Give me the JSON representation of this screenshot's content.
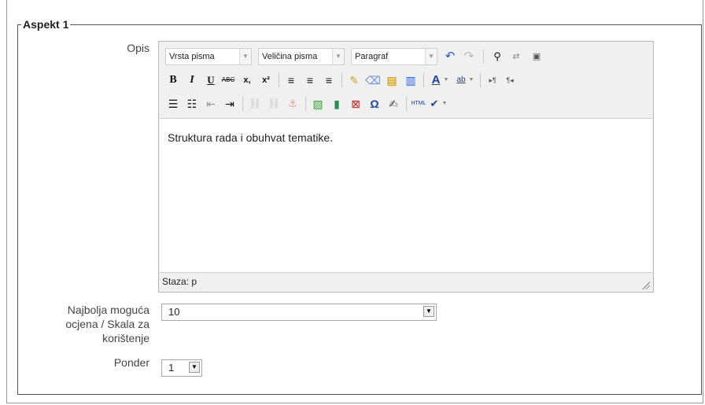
{
  "fieldset": {
    "legend": "Aspekt 1"
  },
  "form": {
    "description_label": "Opis",
    "best_grade_label_line1": "Najbolja moguća",
    "best_grade_label_line2": "ocjena / Skala za",
    "best_grade_label_line3": "korištenje",
    "best_grade_value": "10",
    "weight_label": "Ponder",
    "weight_value": "1"
  },
  "editor": {
    "font_family": "Vrsta pisma",
    "font_size": "Veličina pisma",
    "format": "Paragraf",
    "content": "Struktura rada i obuhvat tematike.",
    "path": "Staza: p",
    "bold": "B",
    "italic": "I",
    "underline": "U",
    "strikethrough": "ABC",
    "subscript": "x,",
    "superscript": "x²"
  },
  "colors": {
    "toolbar_bg": "#f0f0ee",
    "border": "#b6b6b6"
  }
}
